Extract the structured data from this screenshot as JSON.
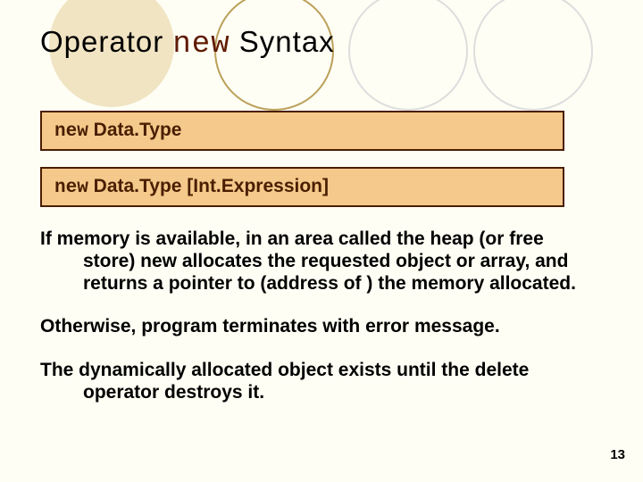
{
  "title": {
    "pre": "Operator ",
    "kw": "new",
    "post": " Syntax"
  },
  "syntax": [
    {
      "kw": "new",
      "rest": "  Data.Type"
    },
    {
      "kw": "new",
      "rest": "  Data.Type  [Int.Expression]"
    }
  ],
  "body": [
    {
      "lead": "If memory is available, in an area called the heap (or ",
      "wrap": "free store) new allocates the requested object or array, and returns a pointer to (address of ) the memory allocated."
    },
    {
      "lead": "Otherwise, program terminates with error message.",
      "wrap": ""
    },
    {
      "lead": "The dynamically allocated object exists until the ",
      "wrap": "delete operator destroys it."
    }
  ],
  "page_number": "13"
}
